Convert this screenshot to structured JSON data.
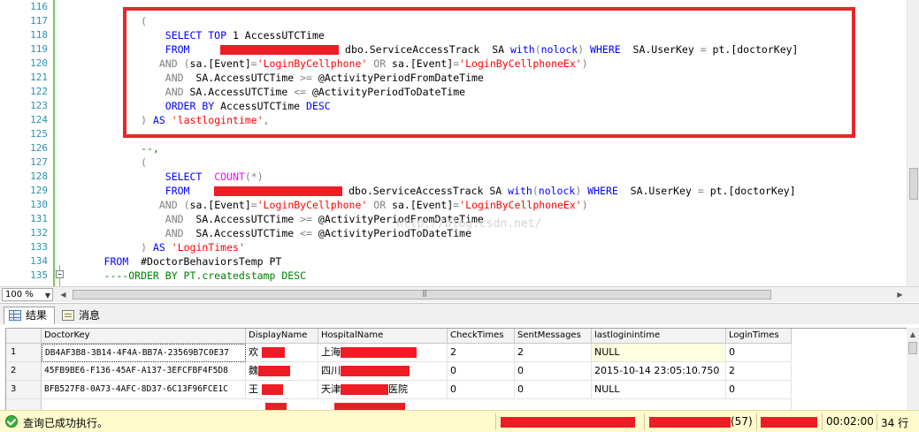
{
  "editor": {
    "line_numbers": [
      "116",
      "117",
      "118",
      "119",
      "120",
      "121",
      "122",
      "123",
      "124",
      "125",
      "126",
      "127",
      "128",
      "129",
      "130",
      "131",
      "132",
      "133",
      "134",
      "135"
    ],
    "lines": [
      [],
      [
        {
          "t": "            (",
          "c": "op"
        }
      ],
      [
        {
          "t": "                ",
          "c": ""
        },
        {
          "t": "SELECT TOP",
          "c": "kw"
        },
        {
          "t": " 1 AccessUTCTime",
          "c": ""
        }
      ],
      [
        {
          "t": "                ",
          "c": ""
        },
        {
          "t": "FROM",
          "c": "kw"
        },
        {
          "t": "     ",
          "c": ""
        },
        {
          "r": 134
        },
        {
          "t": " dbo.ServiceAccessTrack  SA ",
          "c": ""
        },
        {
          "t": "with",
          "c": "kw"
        },
        {
          "t": "(",
          "c": "op"
        },
        {
          "t": "nolock",
          "c": "kw"
        },
        {
          "t": ")",
          "c": "op"
        },
        {
          "t": " ",
          "c": ""
        },
        {
          "t": "WHERE",
          "c": "kw"
        },
        {
          "t": "  SA.UserKey ",
          "c": ""
        },
        {
          "t": "=",
          "c": "op"
        },
        {
          "t": " pt.[doctorKey]",
          "c": ""
        }
      ],
      [
        {
          "t": "               ",
          "c": ""
        },
        {
          "t": "AND",
          "c": "op"
        },
        {
          "t": " ",
          "c": ""
        },
        {
          "t": "(",
          "c": "op"
        },
        {
          "t": "sa.[Event]",
          "c": ""
        },
        {
          "t": "=",
          "c": "op"
        },
        {
          "t": "'LoginByCellphone'",
          "c": "str"
        },
        {
          "t": " ",
          "c": ""
        },
        {
          "t": "OR",
          "c": "op"
        },
        {
          "t": " sa.[Event]",
          "c": ""
        },
        {
          "t": "=",
          "c": "op"
        },
        {
          "t": "'LoginByCellphoneEx'",
          "c": "str"
        },
        {
          "t": ")",
          "c": "op"
        }
      ],
      [
        {
          "t": "                ",
          "c": ""
        },
        {
          "t": "AND",
          "c": "op"
        },
        {
          "t": "  SA.AccessUTCTime ",
          "c": ""
        },
        {
          "t": ">=",
          "c": "op"
        },
        {
          "t": " @ActivityPeriodFromDateTime",
          "c": ""
        }
      ],
      [
        {
          "t": "                ",
          "c": ""
        },
        {
          "t": "AND",
          "c": "op"
        },
        {
          "t": " SA.AccessUTCTime ",
          "c": ""
        },
        {
          "t": "<=",
          "c": "op"
        },
        {
          "t": " @ActivityPeriodToDateTime",
          "c": ""
        }
      ],
      [
        {
          "t": "                ",
          "c": ""
        },
        {
          "t": "ORDER BY",
          "c": "kw"
        },
        {
          "t": " AccessUTCTime ",
          "c": ""
        },
        {
          "t": "DESC",
          "c": "kw"
        }
      ],
      [
        {
          "t": "            ",
          "c": ""
        },
        {
          "t": ")",
          "c": "op"
        },
        {
          "t": " ",
          "c": ""
        },
        {
          "t": "AS",
          "c": "kw"
        },
        {
          "t": " ",
          "c": ""
        },
        {
          "t": "'lastlogintime'",
          "c": "str"
        },
        {
          "t": ",",
          "c": "op"
        }
      ],
      [],
      [
        {
          "t": "            ",
          "c": ""
        },
        {
          "t": "--,",
          "c": "cm"
        }
      ],
      [
        {
          "t": "            ",
          "c": ""
        },
        {
          "t": "(",
          "c": "op"
        }
      ],
      [
        {
          "t": "                ",
          "c": ""
        },
        {
          "t": "SELECT",
          "c": "kw"
        },
        {
          "t": "  ",
          "c": ""
        },
        {
          "t": "COUNT",
          "c": "fn"
        },
        {
          "t": "(",
          "c": "op"
        },
        {
          "t": "*",
          "c": "op"
        },
        {
          "t": ")",
          "c": "op"
        }
      ],
      [
        {
          "t": "                ",
          "c": ""
        },
        {
          "t": "FROM",
          "c": "kw"
        },
        {
          "t": "    ",
          "c": ""
        },
        {
          "r": 145
        },
        {
          "t": " dbo.ServiceAccessTrack SA ",
          "c": ""
        },
        {
          "t": "with",
          "c": "kw"
        },
        {
          "t": "(",
          "c": "op"
        },
        {
          "t": "nolock",
          "c": "kw"
        },
        {
          "t": ")",
          "c": "op"
        },
        {
          "t": " ",
          "c": ""
        },
        {
          "t": "WHERE",
          "c": "kw"
        },
        {
          "t": "  SA.UserKey ",
          "c": ""
        },
        {
          "t": "=",
          "c": "op"
        },
        {
          "t": " pt.[doctorKey]",
          "c": ""
        }
      ],
      [
        {
          "t": "               ",
          "c": ""
        },
        {
          "t": "AND",
          "c": "op"
        },
        {
          "t": " ",
          "c": ""
        },
        {
          "t": "(",
          "c": "op"
        },
        {
          "t": "sa.[Event]",
          "c": ""
        },
        {
          "t": "=",
          "c": "op"
        },
        {
          "t": "'LoginByCellphone'",
          "c": "str"
        },
        {
          "t": " ",
          "c": ""
        },
        {
          "t": "OR",
          "c": "op"
        },
        {
          "t": " sa.[Event]",
          "c": ""
        },
        {
          "t": "=",
          "c": "op"
        },
        {
          "t": "'LoginByCellphoneEx'",
          "c": "str"
        },
        {
          "t": ")",
          "c": "op"
        }
      ],
      [
        {
          "t": "                ",
          "c": ""
        },
        {
          "t": "AND",
          "c": "op"
        },
        {
          "t": "  SA.AccessUTCTime ",
          "c": ""
        },
        {
          "t": ">=",
          "c": "op"
        },
        {
          "t": " @ActivityPeriodFromDateTime",
          "c": ""
        }
      ],
      [
        {
          "t": "                ",
          "c": ""
        },
        {
          "t": "AND",
          "c": "op"
        },
        {
          "t": "  SA.AccessUTCTime ",
          "c": ""
        },
        {
          "t": "<=",
          "c": "op"
        },
        {
          "t": " @ActivityPeriodToDateTime",
          "c": ""
        }
      ],
      [
        {
          "t": "            ",
          "c": ""
        },
        {
          "t": ")",
          "c": "op"
        },
        {
          "t": " ",
          "c": ""
        },
        {
          "t": "AS",
          "c": "kw"
        },
        {
          "t": " ",
          "c": ""
        },
        {
          "t": "'LoginTimes'",
          "c": "str"
        }
      ],
      [
        {
          "t": "      ",
          "c": ""
        },
        {
          "t": "FROM",
          "c": "kw"
        },
        {
          "t": "  #DoctorBehaviorsTemp PT",
          "c": ""
        }
      ],
      [
        {
          "t": "      ",
          "c": ""
        },
        {
          "t": "----ORDER BY PT.createdstamp DESC",
          "c": "cm"
        }
      ]
    ],
    "watermark": "http://blog.csdn.net/"
  },
  "zoom": {
    "value": "100 %"
  },
  "tabs": {
    "results": "结果",
    "messages": "消息"
  },
  "grid": {
    "columns": [
      "DoctorKey",
      "DisplayName",
      "HospitalName",
      "CheckTimes",
      "SentMessages",
      "lastloginintime",
      "LoginTimes"
    ],
    "rows": [
      {
        "num": "1",
        "key": "DB4AF3B8-3B14-4F4A-BB7A-23569B7C0E37",
        "name": "欢",
        "hospital": "上海",
        "check": "2",
        "sent": "2",
        "last": "NULL",
        "logins": "0"
      },
      {
        "num": "2",
        "key": "45FB9BE6-F136-45AF-A137-3EFCFBF4F5D8",
        "name": "魏",
        "hospital": "四川",
        "check": "0",
        "sent": "0",
        "last": "2015-10-14 23:05:10.750",
        "logins": "2"
      },
      {
        "num": "3",
        "key": "BFB527F8-0A73-4AFC-8D37-6C13F96FCE1C",
        "name": "王",
        "hospital": "天津",
        "hospital_suffix": "医院",
        "check": "0",
        "sent": "0",
        "last": "NULL",
        "logins": "0"
      }
    ]
  },
  "status": {
    "message": "查询已成功执行。",
    "session": "(57)",
    "elapsed": "00:02:00",
    "rows": "34 行"
  },
  "colors": {
    "keyword": "#0000ff",
    "string": "#ff0000",
    "operator": "#808080",
    "function": "#ff00ff",
    "comment": "#008000",
    "line_number": "#2b91af",
    "highlight_box": "#e8262a",
    "redaction": "#ee1c25",
    "status_bg": "#fffbcc"
  },
  "icons": {
    "results_tab": "grid-icon",
    "messages_tab": "message-icon",
    "status": "check-circle-icon",
    "fold": "fold-minus-icon"
  }
}
